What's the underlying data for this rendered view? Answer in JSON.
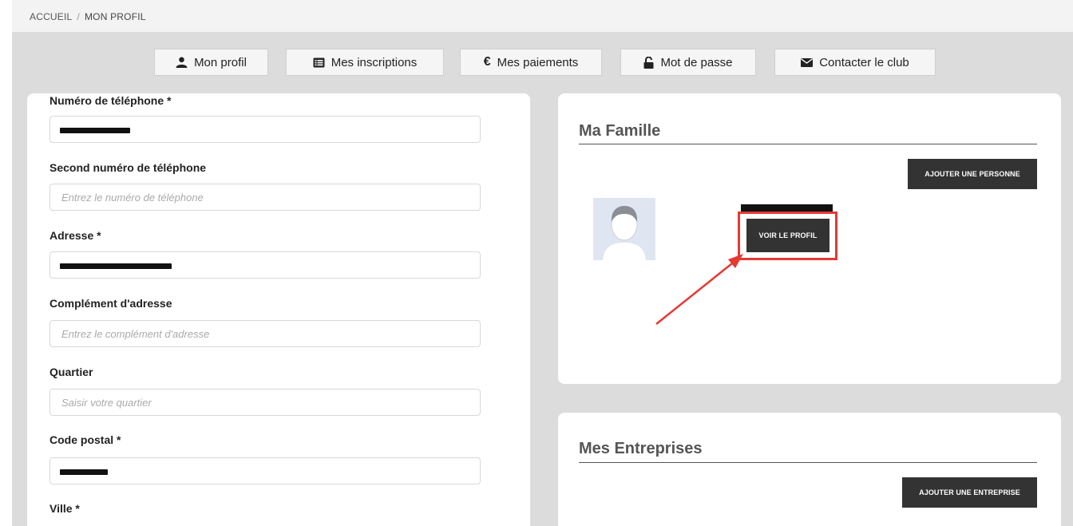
{
  "breadcrumb": {
    "home": "ACCUEIL",
    "separator": "/",
    "current": "MON PROFIL"
  },
  "tabs": [
    {
      "label": "Mon profil",
      "icon": "user-icon"
    },
    {
      "label": "Mes inscriptions",
      "icon": "list-icon"
    },
    {
      "label": "Mes paiements",
      "icon": "euro-icon"
    },
    {
      "label": "Mot de passe",
      "icon": "unlock-icon"
    },
    {
      "label": "Contacter le club",
      "icon": "envelope-icon"
    }
  ],
  "form": {
    "phone_label": "Numéro de téléphone *",
    "phone2_label": "Second numéro de téléphone",
    "phone2_placeholder": "Entrez le numéro de téléphone",
    "address_label": "Adresse *",
    "address2_label": "Complément d'adresse",
    "address2_placeholder": "Entrez le complément d'adresse",
    "district_label": "Quartier",
    "district_placeholder": "Saisir votre quartier",
    "postal_label": "Code postal *",
    "city_label": "Ville *"
  },
  "family": {
    "title": "Ma Famille",
    "add_button": "AJOUTER UNE PERSONNE",
    "view_profile_button": "VOIR LE PROFIL"
  },
  "companies": {
    "title": "Mes Entreprises",
    "add_button": "AJOUTER UNE ENTREPRISE"
  },
  "colors": {
    "page_bg": "#dcdcdc",
    "dark_button": "#333333",
    "annotation_red": "#e53935"
  }
}
